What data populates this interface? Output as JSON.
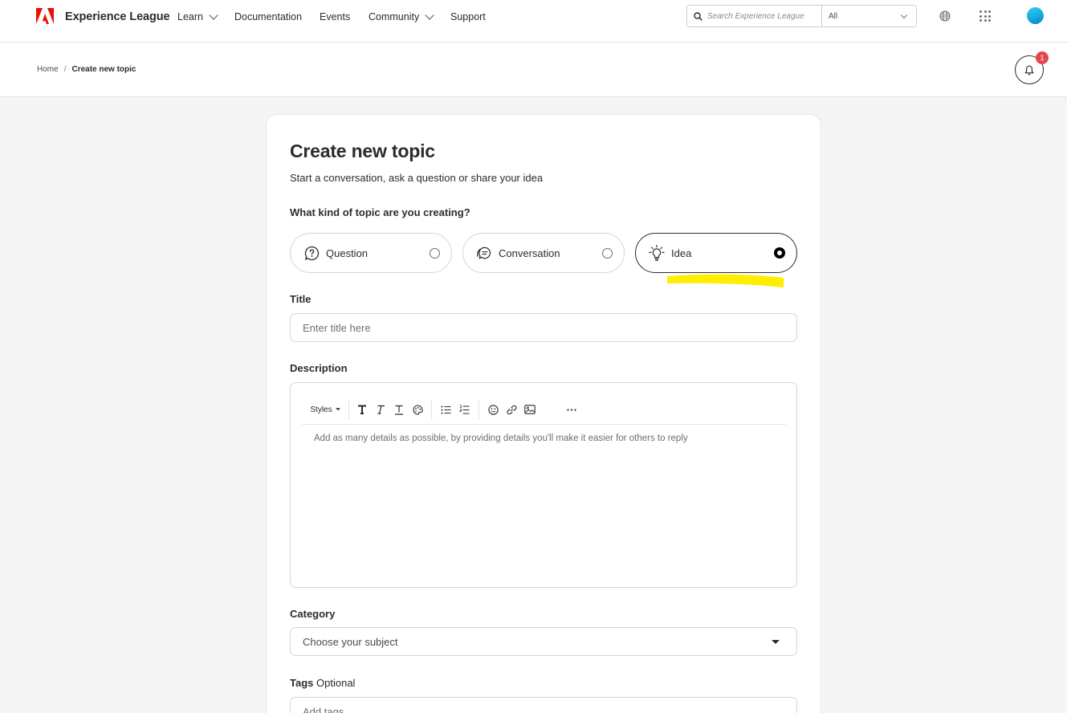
{
  "nav": {
    "brand": "Experience League",
    "items": [
      {
        "label": "Learn",
        "has_dropdown": true
      },
      {
        "label": "Documentation",
        "has_dropdown": false
      },
      {
        "label": "Events",
        "has_dropdown": false
      },
      {
        "label": "Community",
        "has_dropdown": true
      },
      {
        "label": "Support",
        "has_dropdown": false
      }
    ],
    "search_placeholder": "Search Experience League",
    "search_scope": "All",
    "accent": "#eb1000"
  },
  "breadcrumb": {
    "home": "Home",
    "separator": "/",
    "current": "Create new topic"
  },
  "notifications": {
    "count": "1"
  },
  "form": {
    "title": "Create new topic",
    "subtitle": "Start a conversation, ask a question or share your idea",
    "kind_question": "What kind of topic are you creating?",
    "options": [
      {
        "label": "Question",
        "icon": "question-icon",
        "selected": false
      },
      {
        "label": "Conversation",
        "icon": "conversation-icon",
        "selected": false
      },
      {
        "label": "Idea",
        "icon": "lightbulb-icon",
        "selected": true
      }
    ],
    "title_label": "Title",
    "title_placeholder": "Enter title here",
    "description_label": "Description",
    "toolbar_styles": "Styles",
    "description_placeholder": "Add as many details as possible, by providing details you'll make it easier for others to reply",
    "category_label": "Category",
    "category_value": "Choose your subject",
    "tags_label": "Tags",
    "tags_optional": "Optional",
    "tags_placeholder": "Add tags",
    "highlight_color": "#ffee00"
  }
}
